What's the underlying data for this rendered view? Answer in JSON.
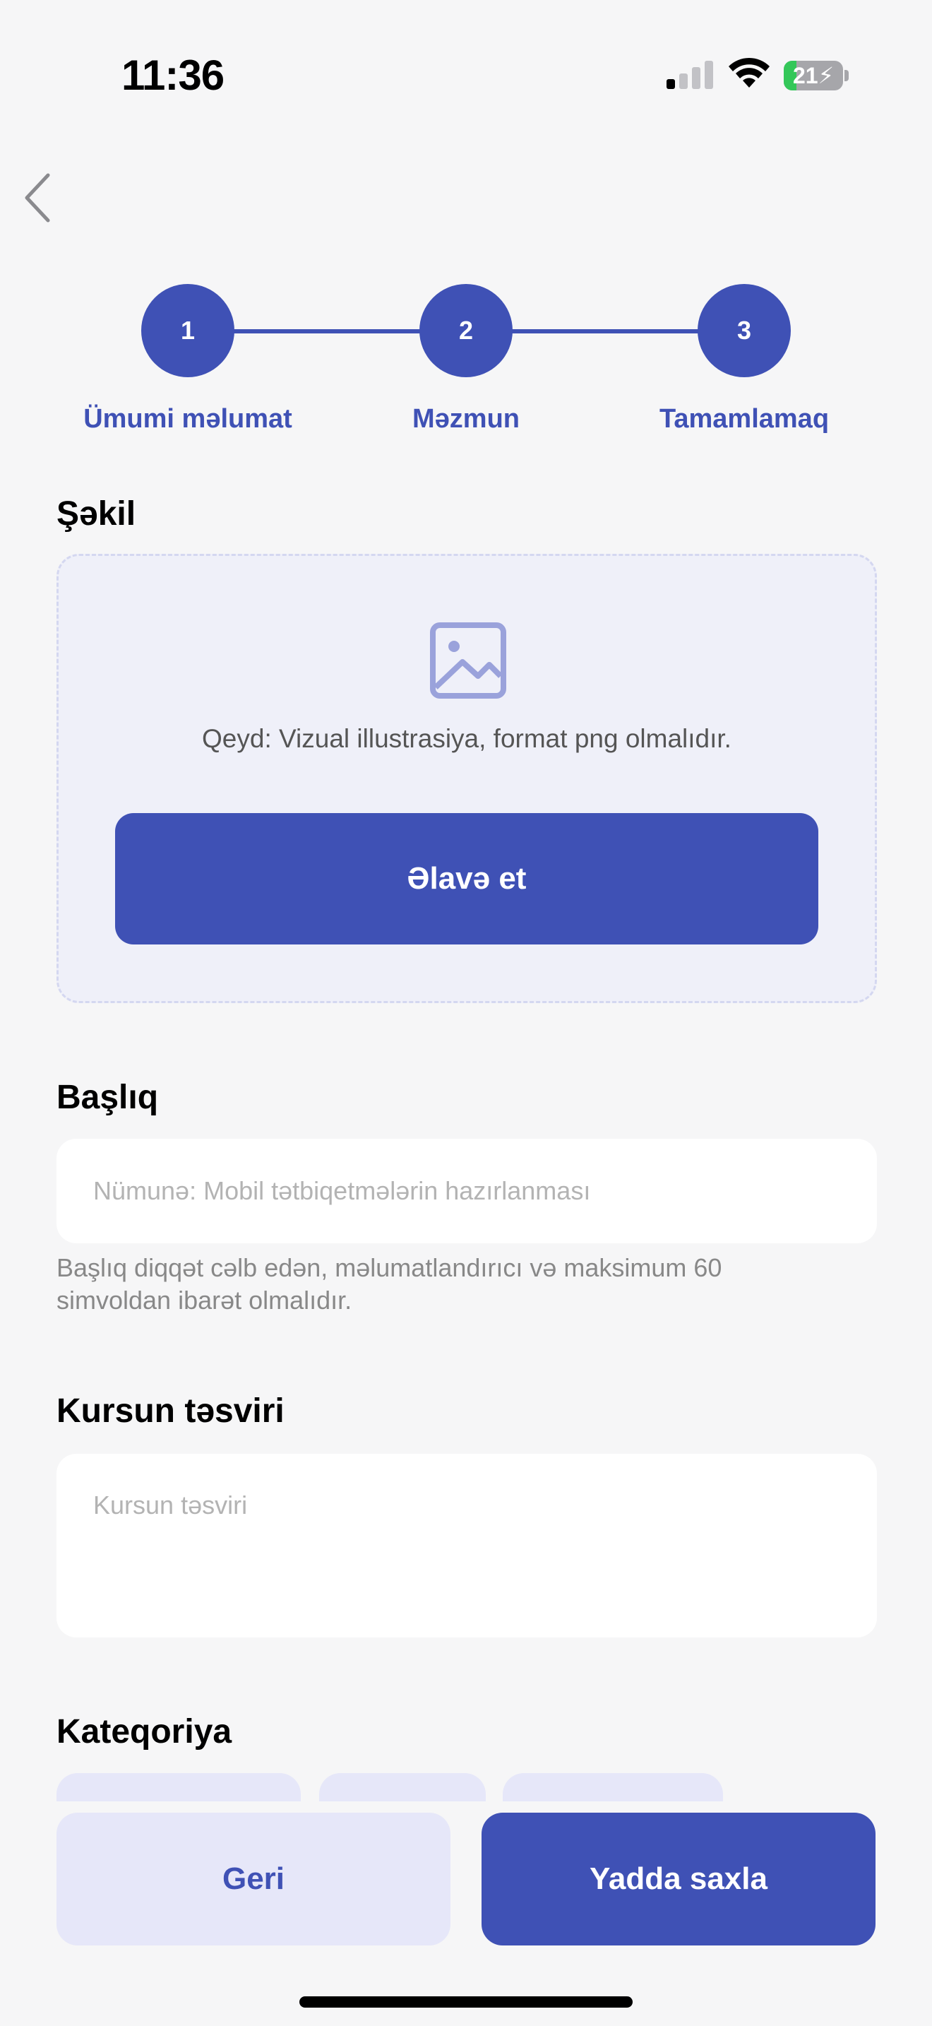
{
  "status_bar": {
    "time": "11:36",
    "battery": "21",
    "battery_level": 0.21
  },
  "stepper": {
    "steps": [
      {
        "number": "1",
        "label": "Ümumi məlumat"
      },
      {
        "number": "2",
        "label": "Məzmun"
      },
      {
        "number": "3",
        "label": "Tamamlamaq"
      }
    ]
  },
  "image_section": {
    "title": "Şəkil",
    "note": "Qeyd: Vizual illustrasiya, format png olmalıdır.",
    "add_button": "Əlavə et"
  },
  "title_section": {
    "title": "Başlıq",
    "placeholder": "Nümunə: Mobil tətbiqetmələrin hazırlanması",
    "hint": "Başlıq diqqət cəlb edən, məlumatlandırıcı və maksimum 60 simvoldan ibarət olmalıdır."
  },
  "description_section": {
    "title": "Kursun təsviri",
    "placeholder": "Kursun təsviri"
  },
  "category_section": {
    "title": "Kateqoriya"
  },
  "footer": {
    "back_label": "Geri",
    "save_label": "Yadda saxla"
  },
  "colors": {
    "accent": "#3f51b5",
    "accent_light": "#e6e7f9",
    "upload_bg": "#eff0f9",
    "background": "#f6f6f7"
  }
}
